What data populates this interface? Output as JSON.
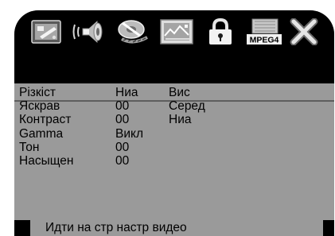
{
  "icons": [
    "general-setup-icon",
    "audio-setup-icon",
    "dolby-digital-setup-icon",
    "video-setup-icon",
    "preference-lock-icon",
    "mpeg4-setup-icon",
    "exit-icon"
  ],
  "icon_labels": {
    "mpeg4": "MPEG4"
  },
  "settings": [
    {
      "label": "Різкіст",
      "value": "Ниа"
    },
    {
      "label": "Яскрав",
      "value": "00"
    },
    {
      "label": "Контраст",
      "value": "00"
    },
    {
      "label": "Gamma",
      "value": "Викл"
    },
    {
      "label": "Тон",
      "value": "00"
    },
    {
      "label": "Насыщен",
      "value": "00"
    }
  ],
  "options": [
    "Вис",
    "Серед",
    "Ниа"
  ],
  "footer": {
    "hint": "Идти на стр настр видео"
  },
  "colors": {
    "panel": "#9a9a9a",
    "bar": "#000000"
  }
}
